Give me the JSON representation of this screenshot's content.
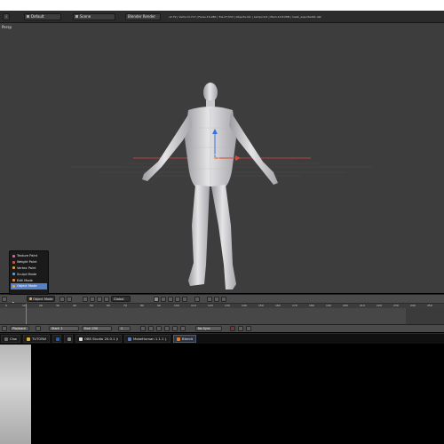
{
  "header": {
    "layout_value": "Default",
    "scene_value": "Scene",
    "render_engine_value": "Blender Render",
    "stats_text": "v2.79 | Verts:13,717 | Faces:15,280 | Tris:27,533 | Objects:0/1 | Lamps:0/1 | Mem:10.8 MiB | mesh_exported01.dat"
  },
  "viewport": {
    "view_label": "Persp"
  },
  "mode_menu": {
    "items": [
      {
        "label": "Texture Paint",
        "icon_color": "#d26a8e"
      },
      {
        "label": "Weight Paint",
        "icon_color": "#c85050"
      },
      {
        "label": "Vertex Paint",
        "icon_color": "#c8a050"
      },
      {
        "label": "Sculpt Mode",
        "icon_color": "#5aa0d0"
      },
      {
        "label": "Edit Mode",
        "icon_color": "#e08a3c"
      },
      {
        "label": "Object Mode",
        "icon_color": "#f0a030"
      }
    ],
    "selected_index": 5
  },
  "view3d_header": {
    "mode_value": "Object Mode",
    "pivot_value": "Global"
  },
  "timeline": {
    "tick_labels": [
      "0",
      "10",
      "20",
      "30",
      "40",
      "50",
      "60",
      "70",
      "80",
      "90",
      "100",
      "110",
      "120",
      "130",
      "140",
      "150",
      "160",
      "170",
      "180",
      "190",
      "200",
      "210",
      "220",
      "230",
      "240",
      "250"
    ],
    "current_frame": 1,
    "start_label": "Start:",
    "start_value": "1",
    "end_label": "End:",
    "end_value": "250",
    "playback_label": "Playback",
    "sync_value": "No Sync"
  },
  "taskbar": {
    "items": [
      {
        "label": "Charac...",
        "icon_color": "#6a6a6a",
        "active": false
      },
      {
        "label": "TUTORIAL",
        "icon_color": "#e0b030",
        "active": false
      },
      {
        "label": "",
        "icon_color": "#2a5caa",
        "active": false
      },
      {
        "label": "",
        "icon_color": "#888888",
        "active": false
      },
      {
        "label": "OBS Studio 20.0.1 (64-bit...",
        "icon_color": "#dddddd",
        "active": false
      },
      {
        "label": "MakeHuman 1.1.1 (...",
        "icon_color": "#5a7ac0",
        "active": false
      },
      {
        "label": "Blender",
        "icon_color": "#f07a20",
        "active": true
      }
    ]
  },
  "colors": {
    "viewport_bg": "#3d3d3d",
    "selection": "#5680c2",
    "axis_x": "#d9463c",
    "axis_y": "#7fbf3f",
    "axis_z": "#3b72d9"
  }
}
